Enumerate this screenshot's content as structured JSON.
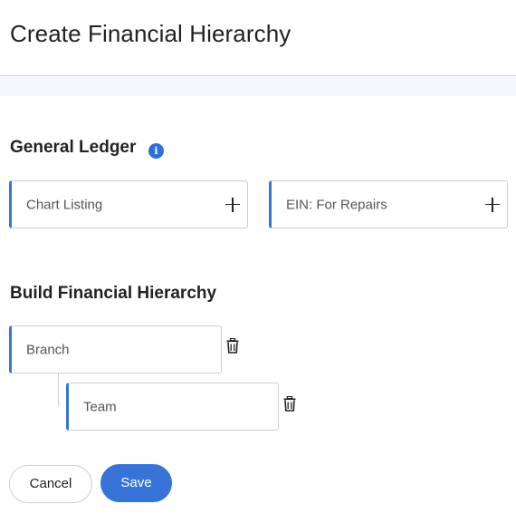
{
  "header": {
    "title": "Create Financial Hierarchy"
  },
  "general_ledger": {
    "title": "General Ledger",
    "info_icon": "info-icon",
    "cards": [
      {
        "label": "Chart Listing",
        "action_icon": "plus-icon"
      },
      {
        "label": "EIN: For Repairs",
        "action_icon": "plus-icon"
      }
    ]
  },
  "build_hierarchy": {
    "title": "Build Financial Hierarchy",
    "nodes": [
      {
        "label": "Branch",
        "action_icon": "trash-icon"
      },
      {
        "label": "Team",
        "action_icon": "trash-icon"
      }
    ]
  },
  "actions": {
    "cancel_label": "Cancel",
    "save_label": "Save"
  },
  "colors": {
    "accent": "#3874d8",
    "info": "#2f6fd6",
    "border": "#c9ced4",
    "band": "#f5f8fb"
  }
}
